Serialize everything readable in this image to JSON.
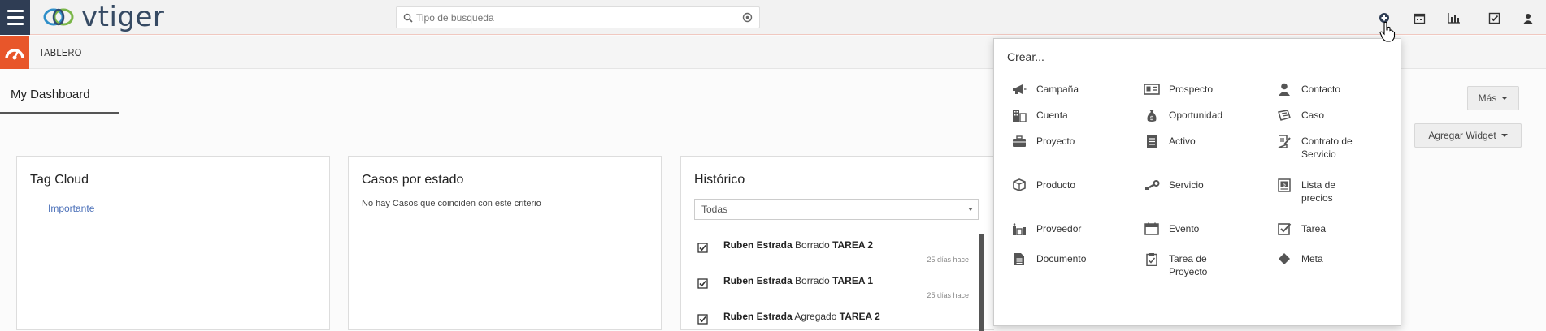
{
  "app": {
    "logo_text": "vtiger"
  },
  "search": {
    "placeholder": "Tipo de busqueda"
  },
  "header_icons": [
    "plus-circle-icon",
    "calendar-icon",
    "chart-icon",
    "checkbox-icon",
    "user-icon"
  ],
  "module": {
    "title": "TABLERO"
  },
  "tabs": {
    "my_dashboard": "My Dashboard"
  },
  "buttons": {
    "more": "Más",
    "add_widget": "Agregar Widget"
  },
  "widgets": {
    "tag_cloud": {
      "title": "Tag Cloud",
      "tag": "Importante"
    },
    "cases": {
      "title": "Casos por estado",
      "empty": "No hay Casos que coinciden con este criterio"
    },
    "history": {
      "title": "Histórico",
      "filter": "Todas",
      "items": [
        {
          "user": "Ruben Estrada",
          "action": "Borrado",
          "target": "TAREA 2",
          "time": "25 días hace"
        },
        {
          "user": "Ruben Estrada",
          "action": "Borrado",
          "target": "TAREA 1",
          "time": "25 días hace"
        },
        {
          "user": "Ruben Estrada",
          "action": "Agregado",
          "target": "TAREA 2",
          "time": ""
        }
      ]
    }
  },
  "create_menu": {
    "title": "Crear...",
    "items": [
      {
        "label": "Campaña",
        "icon": "megaphone-icon"
      },
      {
        "label": "Prospecto",
        "icon": "id-card-icon"
      },
      {
        "label": "Contacto",
        "icon": "person-icon"
      },
      {
        "label": "Cuenta",
        "icon": "building-icon"
      },
      {
        "label": "Oportunidad",
        "icon": "money-bag-icon"
      },
      {
        "label": "Caso",
        "icon": "ticket-icon"
      },
      {
        "label": "Proyecto",
        "icon": "briefcase-icon"
      },
      {
        "label": "Activo",
        "icon": "server-icon"
      },
      {
        "label": "Contrato de Servicio",
        "icon": "contract-icon"
      },
      {
        "label": "Producto",
        "icon": "box-icon"
      },
      {
        "label": "Servicio",
        "icon": "wrench-icon"
      },
      {
        "label": "Lista de precios",
        "icon": "price-list-icon"
      },
      {
        "label": "Proveedor",
        "icon": "vendor-icon"
      },
      {
        "label": "Evento",
        "icon": "calendar-event-icon"
      },
      {
        "label": "Tarea",
        "icon": "check-square-icon"
      },
      {
        "label": "Documento",
        "icon": "document-icon"
      },
      {
        "label": "Tarea de Proyecto",
        "icon": "clipboard-icon"
      },
      {
        "label": "Meta",
        "icon": "diamond-icon"
      }
    ]
  },
  "colors": {
    "topbar_dark": "#2f3d54",
    "module_accent": "#e8562a",
    "link": "#4a6fb8"
  }
}
